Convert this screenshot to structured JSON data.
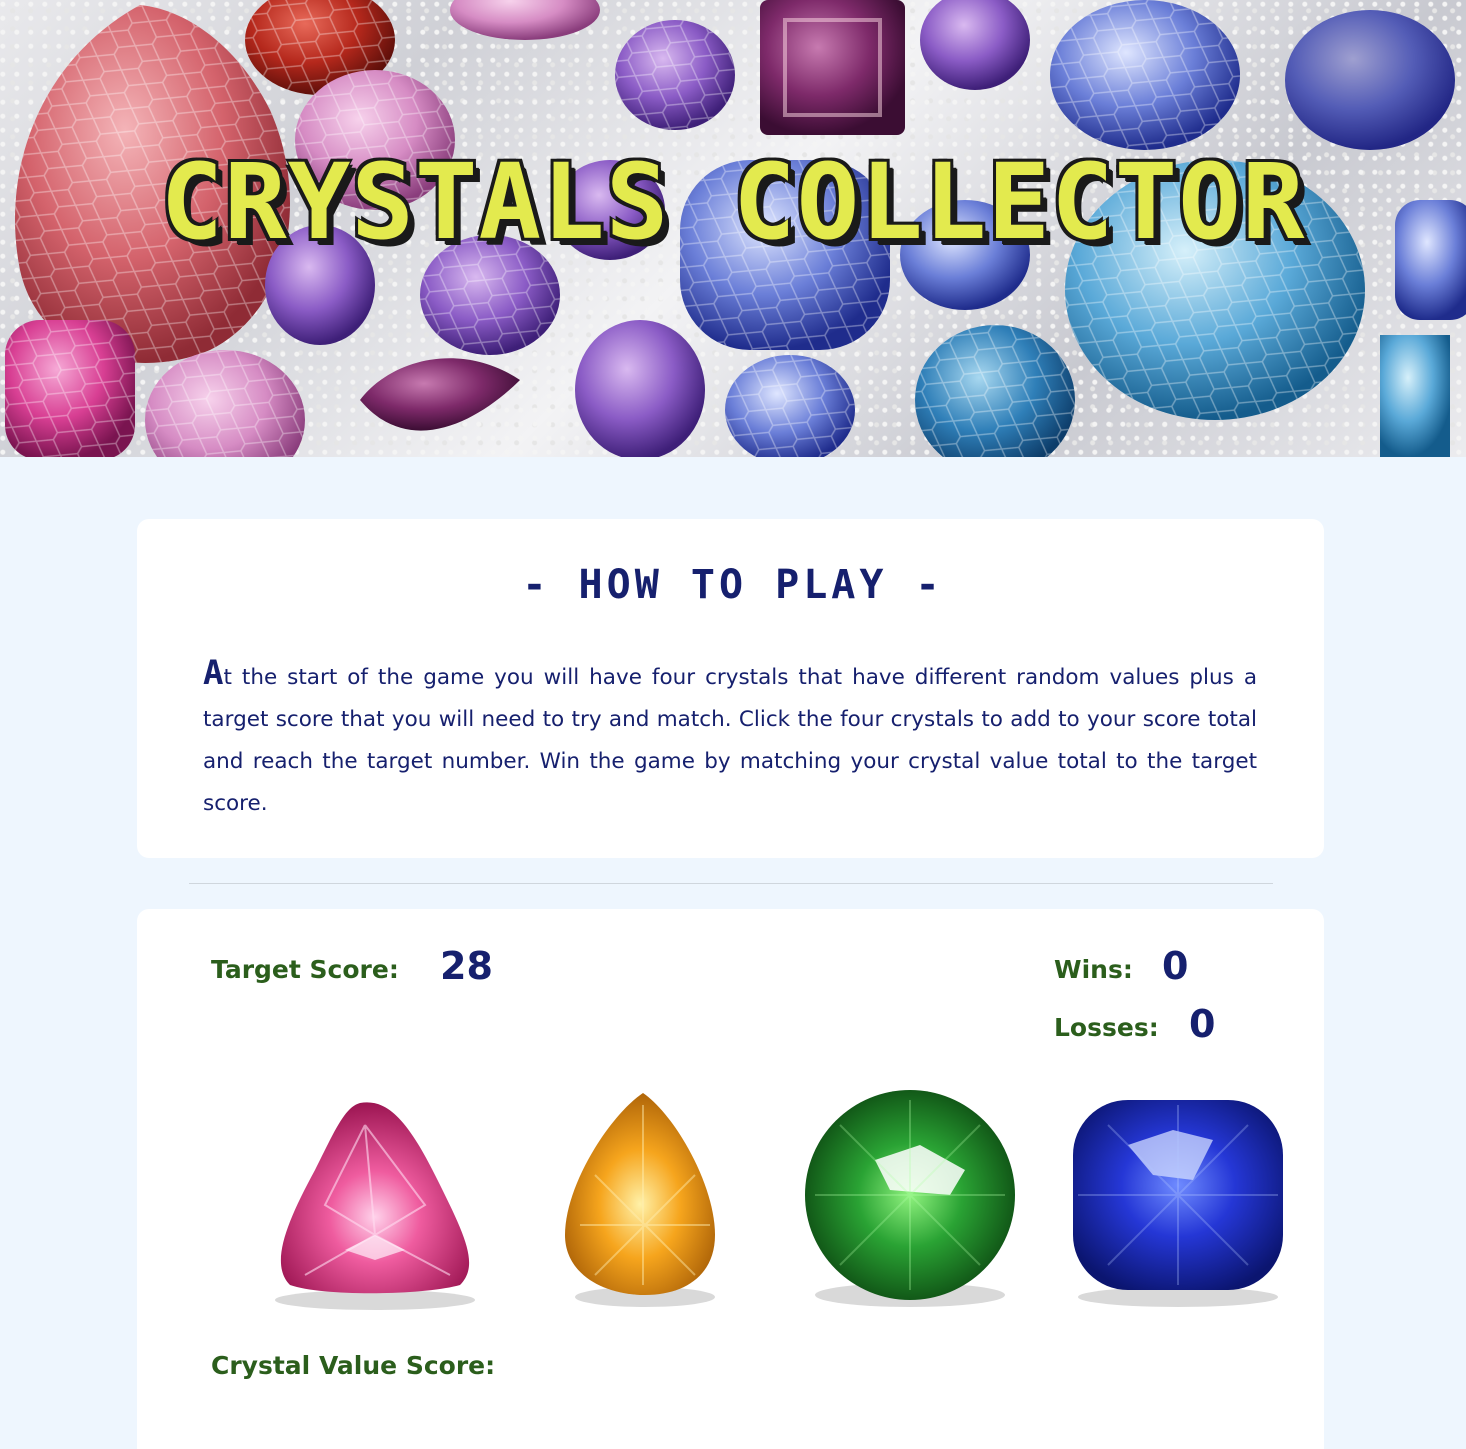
{
  "header": {
    "title": "CRYSTALS COLLECTOR"
  },
  "how_to_play": {
    "title": "- HOW TO PLAY -",
    "dropcap": "A",
    "text": "t the start of the game you will have four crystals that have different random values plus a target score that you will need to try and match. Click the four crystals to add to your score total and reach the target number. Win the game by matching your crystal value total to the target score."
  },
  "game": {
    "target_label": "Target Score:",
    "target_value": "28",
    "wins_label": "Wins:",
    "wins_value": "0",
    "losses_label": "Losses:",
    "losses_value": "0",
    "crystal_value_label": "Crystal Value Score:",
    "crystal_value": "",
    "crystals": [
      {
        "name": "pink-trillion-crystal",
        "color": "#e0417f"
      },
      {
        "name": "orange-pear-crystal",
        "color": "#f0a21c"
      },
      {
        "name": "green-round-crystal",
        "color": "#1f8a2b"
      },
      {
        "name": "blue-cushion-crystal",
        "color": "#2235c8"
      }
    ]
  }
}
